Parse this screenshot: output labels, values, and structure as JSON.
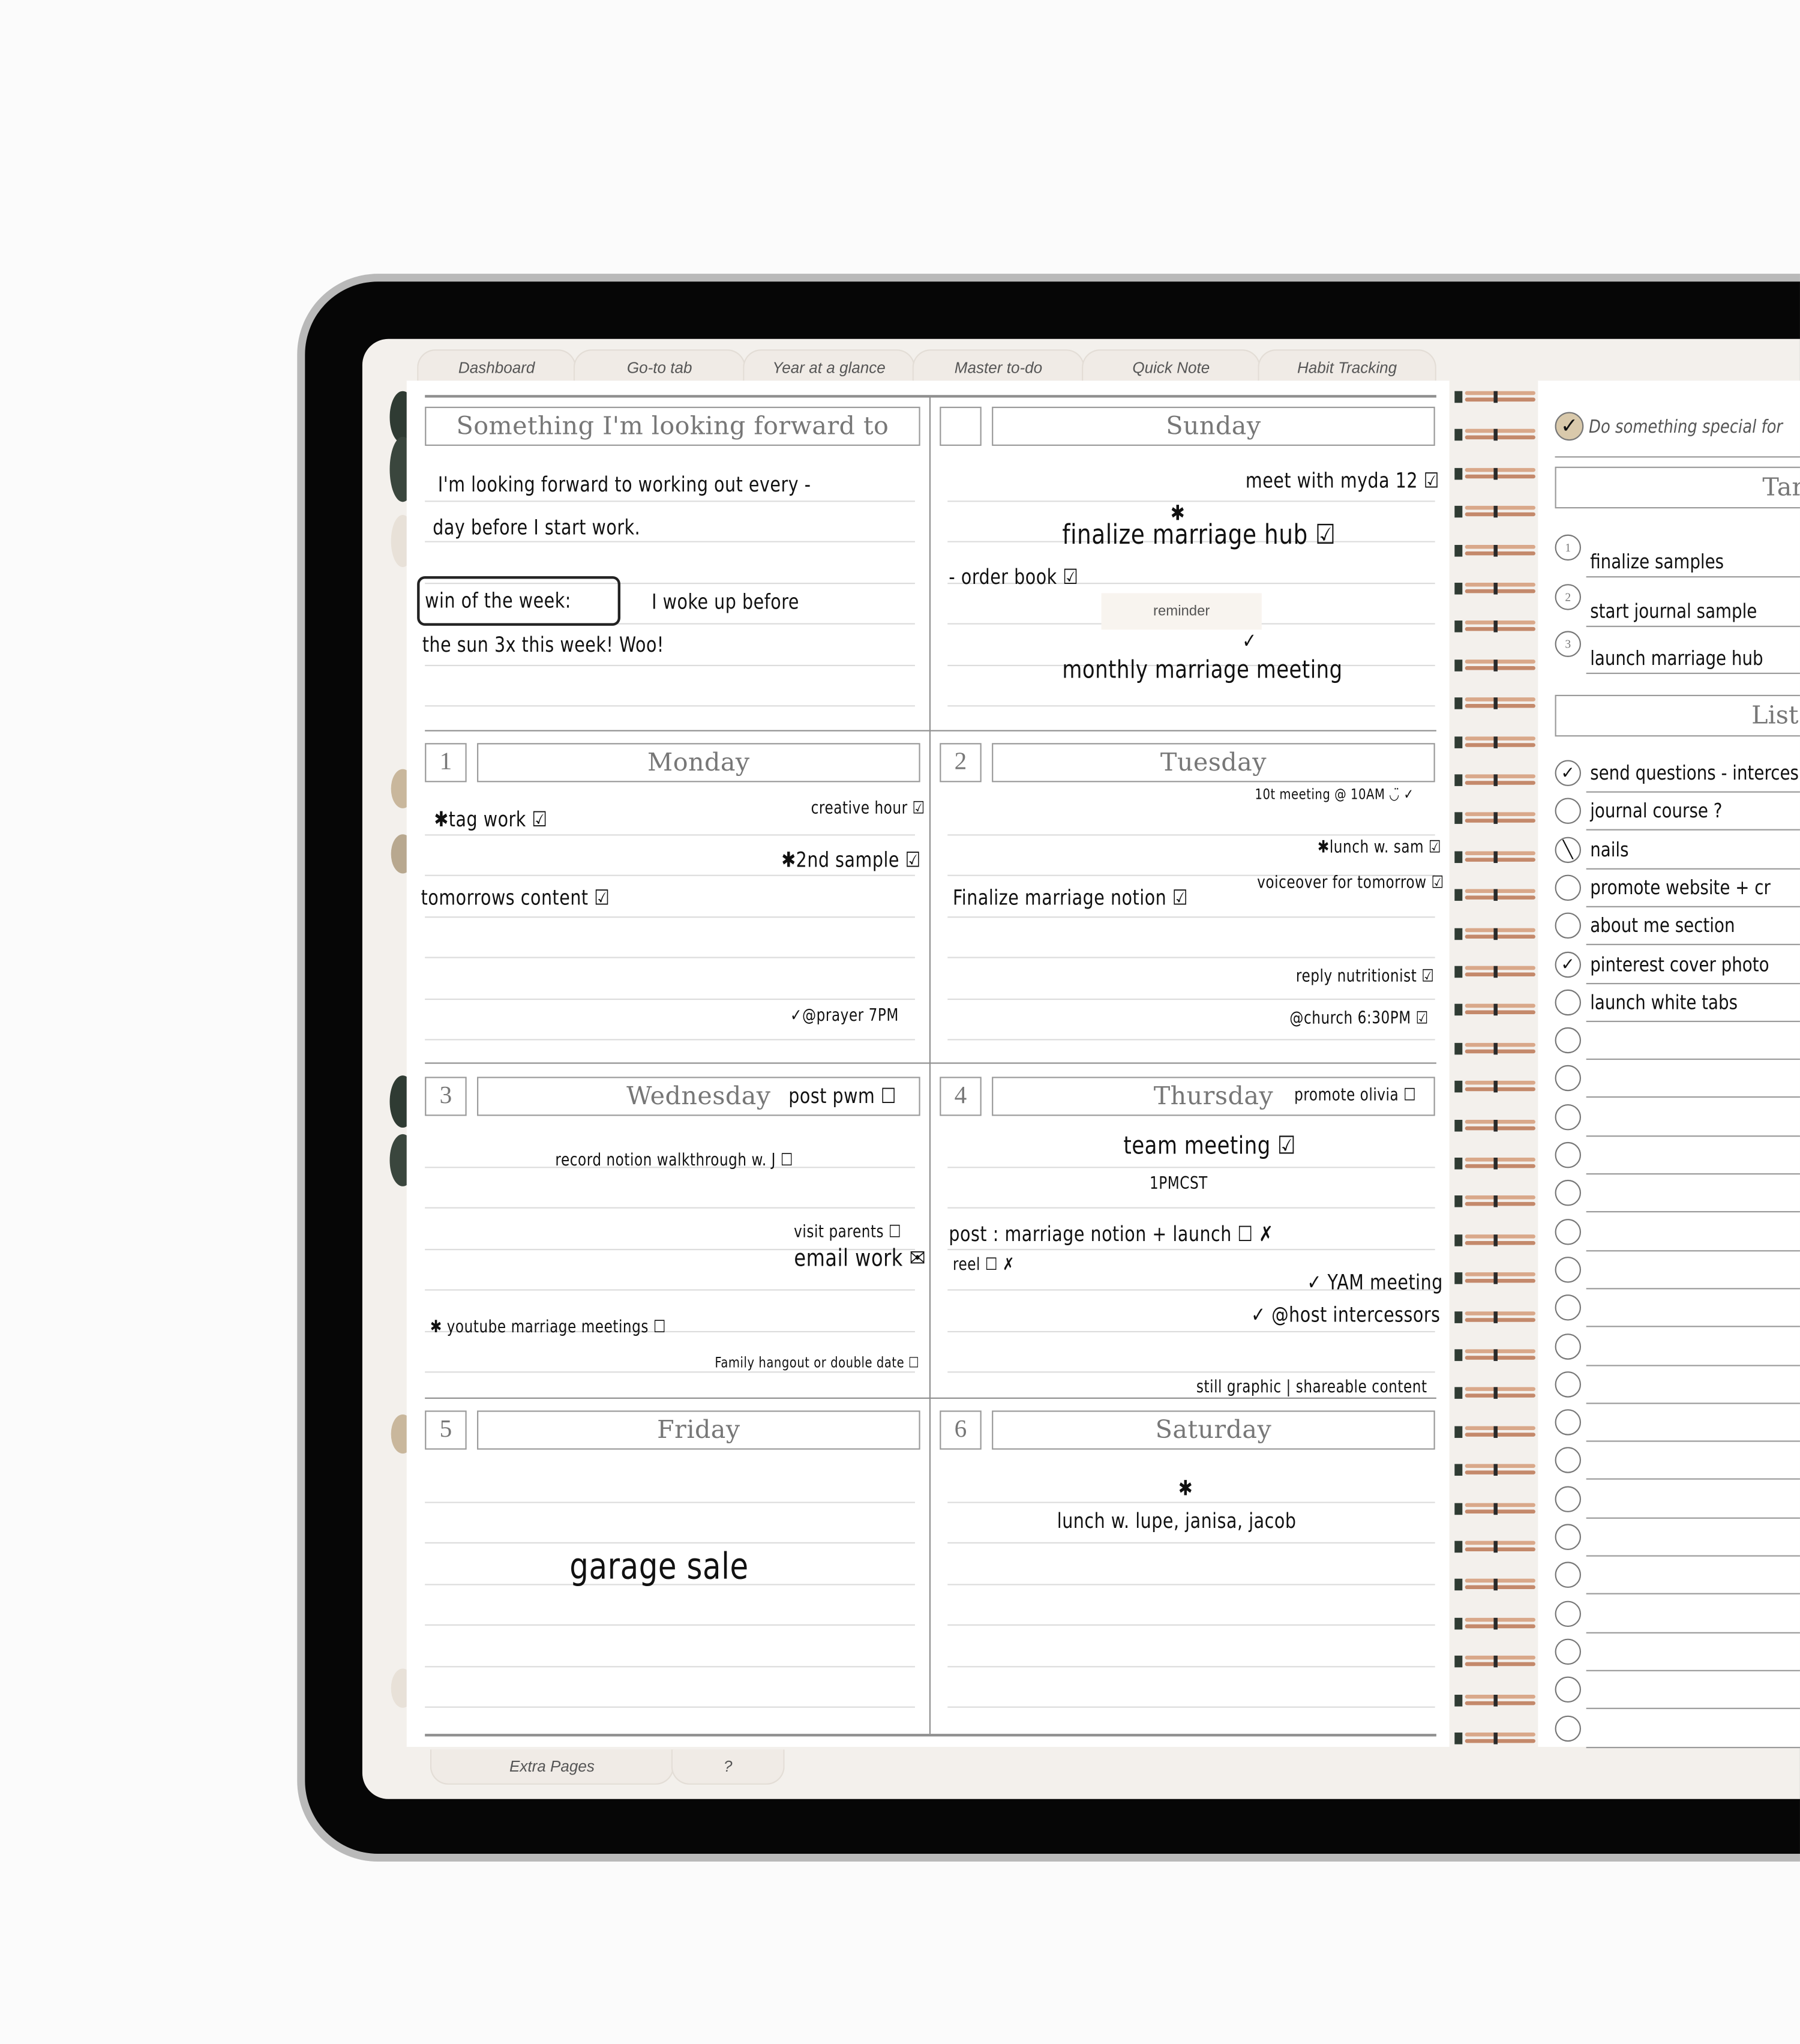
{
  "top_tabs": [
    "Dashboard",
    "Go-to tab",
    "Year at a glance",
    "Master to-do",
    "Quick Note",
    "Habit Tracking"
  ],
  "bottom_tabs": [
    "Extra Pages",
    "?"
  ],
  "colors": {
    "page": "#ffffff",
    "screen": "#f3f0ec",
    "accent_green": "#2f3b33",
    "accent_beige": "#c9b79c",
    "ring": "#d9a88a"
  },
  "forward": {
    "title": "Something I'm looking forward to",
    "notes": [
      "I'm  looking forward to working out every -",
      "day  before  I start  work.",
      "win  of the  week:",
      "I   woke  up  before",
      "the  sun  3x this week!  Woo!"
    ]
  },
  "days": [
    {
      "num": "",
      "name": "Sunday",
      "notes": [
        "meet with myda 12 ☑",
        "✱",
        "finalize marriage hub ☑",
        "- order book ☑",
        "reminder",
        "✓",
        "monthly marriage meeting"
      ]
    },
    {
      "num": "1",
      "name": "Monday",
      "notes": [
        "✱tag work ☑",
        "creative hour ☑",
        "✱2nd sample ☑",
        "tomorrows content ☑",
        "✓@prayer 7PM"
      ]
    },
    {
      "num": "2",
      "name": "Tuesday",
      "notes": [
        "10t meeting @ 10AM ◡̈ ✓",
        "✱lunch w. sam ☑",
        "voiceover for tomorrow ☑",
        "Finalize marriage notion ☑",
        "reply nutritionist ☑",
        "@church 6:30PM ☑"
      ]
    },
    {
      "num": "3",
      "name": "Wednesday",
      "header_note": "post pwm ☐",
      "notes": [
        "record notion walkthrough w. J ☐",
        "visit parents ☐",
        "email work ✉",
        "✱ youtube marriage meetings ☐",
        "Family hangout or double date ☐"
      ]
    },
    {
      "num": "4",
      "name": "Thursday",
      "header_note": "promote olivia ☐",
      "notes": [
        "team meeting ☑",
        "1PMCST",
        "post : marriage notion + launch ☐ ✗",
        "reel ☐ ✗",
        "✓ YAM meeting",
        "✓ @host intercessors",
        "still graphic | shareable content"
      ]
    },
    {
      "num": "5",
      "name": "Friday",
      "notes": [
        "garage sale"
      ]
    },
    {
      "num": "6",
      "name": "Saturday",
      "notes": [
        "✱",
        "lunch w. lupe, janisa, jacob"
      ]
    }
  ],
  "right_page": {
    "special": {
      "label": "Do something special for",
      "checked": true
    },
    "target_title": "Targ",
    "targets": [
      "finalize samples",
      "start journal sample",
      "launch marriage hub"
    ],
    "list_title": "List i",
    "list_items": [
      {
        "text": "send questions - interces",
        "state": "checked"
      },
      {
        "text": "journal course ?",
        "state": "empty"
      },
      {
        "text": "nails",
        "state": "slash"
      },
      {
        "text": "promote website + cr",
        "state": "empty"
      },
      {
        "text": "about me section",
        "state": "empty"
      },
      {
        "text": "pinterest cover photo",
        "state": "checked"
      },
      {
        "text": "launch white tabs",
        "state": "empty"
      }
    ],
    "empty_rows": 19
  }
}
